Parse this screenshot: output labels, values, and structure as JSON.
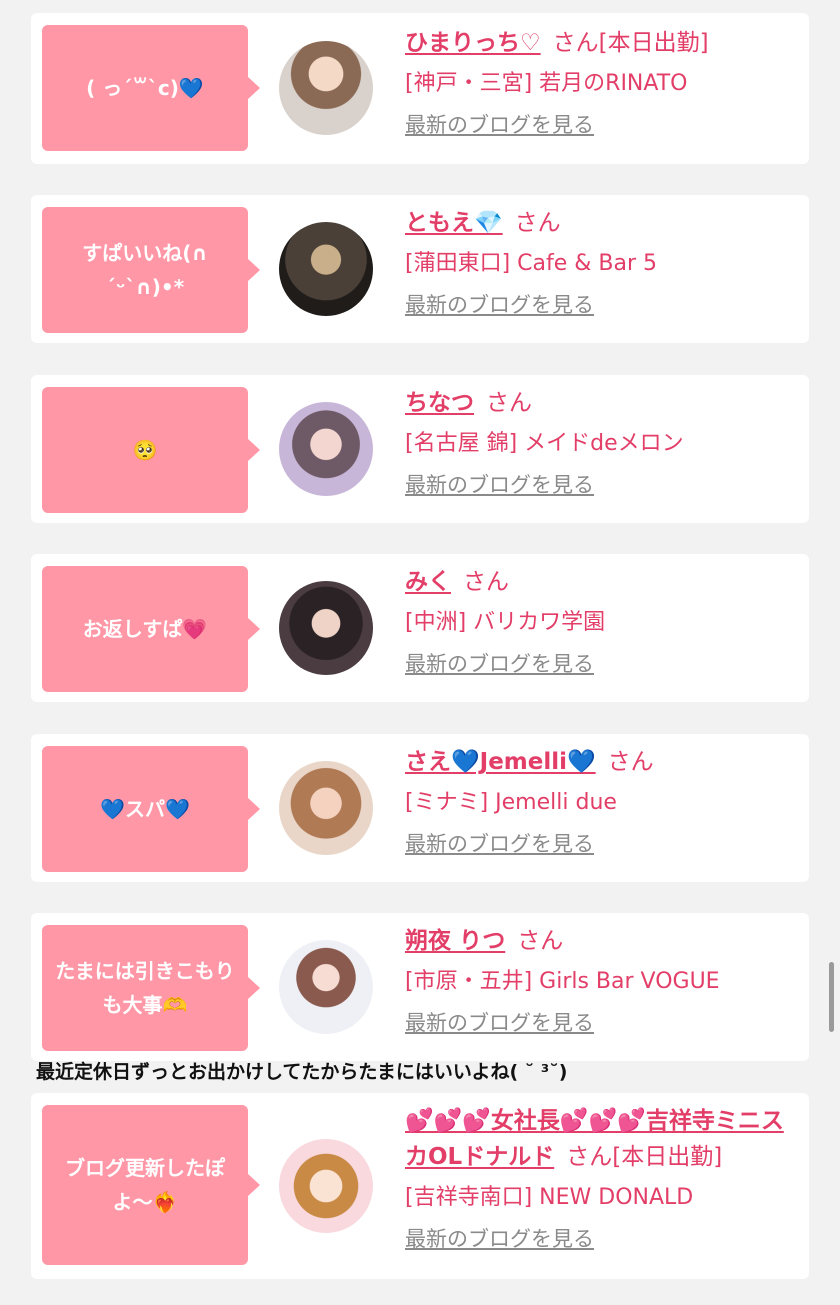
{
  "cards": [
    {
      "bubble": "( っ´꒳`c)💙",
      "name": "ひまりっち♡",
      "san_text": "さん",
      "status": "[本日出勤]",
      "shop": "[神戸・三宮] 若月のRINATO",
      "blog_link": "最新のブログを見る"
    },
    {
      "bubble": "すぱいいね(∩´ᵕ`∩)•*",
      "name": "ともえ💎",
      "san_text": "さん",
      "status": "",
      "shop": "[蒲田東口] Cafe & Bar 5",
      "blog_link": "最新のブログを見る"
    },
    {
      "bubble": "🥺",
      "name": "ちなつ",
      "san_text": "さん",
      "status": "",
      "shop": "[名古屋 錦] メイドdeメロン",
      "blog_link": "最新のブログを見る"
    },
    {
      "bubble": "お返しすぱ💗",
      "name": "みく",
      "san_text": "さん",
      "status": "",
      "shop": "[中洲] バリカワ学園",
      "blog_link": "最新のブログを見る"
    },
    {
      "bubble": "💙スパ💙",
      "name": "さえ💙Jemelli💙",
      "san_text": "さん",
      "status": "",
      "shop": "[ミナミ] Jemelli due",
      "blog_link": "最新のブログを見る"
    },
    {
      "bubble": "たまには引きこもりも大事🫶",
      "name": "朔夜 りつ",
      "san_text": "さん",
      "status": "",
      "shop": "[市原・五井] Girls Bar VOGUE",
      "blog_link": "最新のブログを見る"
    },
    {
      "bubble": "ブログ更新したぽよ〜❤️‍🔥",
      "name": "💕💕💕女社長💕💕💕吉祥寺ミニスカOLドナルド",
      "san_text": "さん",
      "status": "[本日出勤]",
      "shop": "[吉祥寺南口] NEW DONALD",
      "blog_link": "最新のブログを見る"
    }
  ],
  "overlay_text": "最近定休日ずっとお出かけしてたからたまにはいいよね( ˘ ³˘)",
  "colors": {
    "bubble": "#ff97a6",
    "accent": "#e23e68",
    "link_gray": "#8a8a8a",
    "background": "#f2f2f2"
  }
}
